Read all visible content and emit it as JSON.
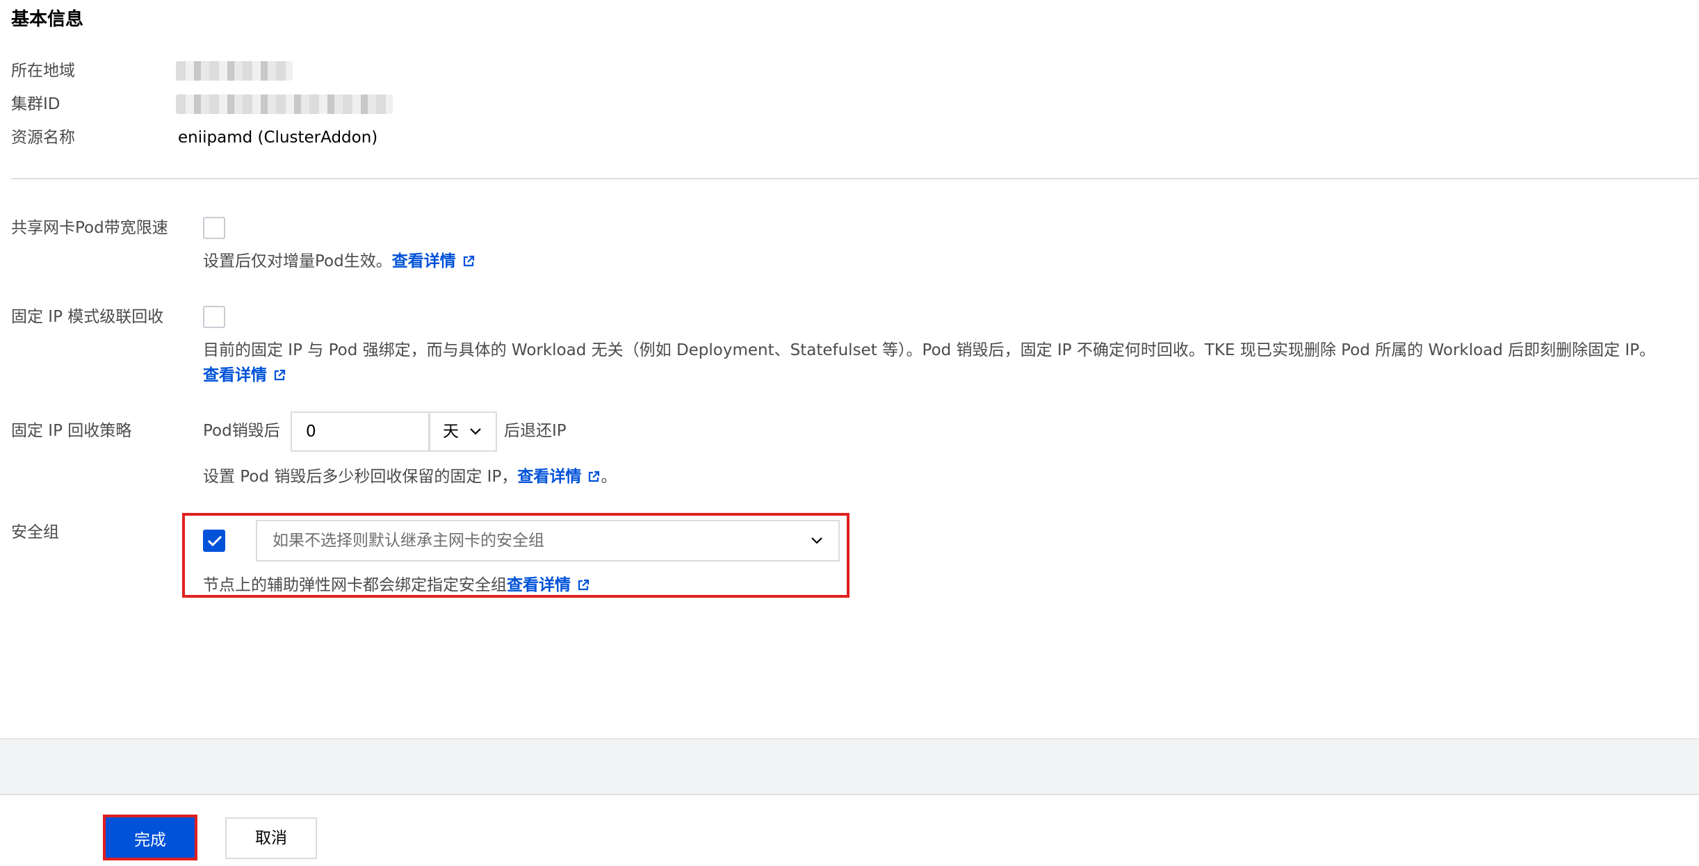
{
  "section_title": "基本信息",
  "basic_info": {
    "region_label": "所在地域",
    "cluster_id_label": "集群ID",
    "resource_name_label": "资源名称",
    "resource_name_value": "eniipamd (ClusterAddon)"
  },
  "bandwidth_limit": {
    "label": "共享网卡Pod带宽限速",
    "checked": false,
    "desc": "设置后仅对增量Pod生效。",
    "link": "查看详情"
  },
  "fixed_ip_cascade": {
    "label": "固定 IP 模式级联回收",
    "checked": false,
    "desc": "目前的固定 IP 与 Pod 强绑定，而与具体的 Workload 无关（例如 Deployment、Statefulset 等）。Pod 销毁后，固定 IP 不确定何时回收。TKE 现已实现删除 Pod 所属的 Workload 后即刻删除固定 IP。",
    "link": "查看详情"
  },
  "fixed_ip_policy": {
    "label": "固定 IP 回收策略",
    "prefix": "Pod销毁后",
    "value": "0",
    "unit": "天",
    "suffix": "后退还IP",
    "desc": "设置 Pod 销毁后多少秒回收保留的固定 IP，",
    "link": "查看详情",
    "desc_end": "。"
  },
  "security_group": {
    "label": "安全组",
    "checked": true,
    "placeholder": "如果不选择则默认继承主网卡的安全组",
    "desc": "节点上的辅助弹性网卡都会绑定指定安全组",
    "link": "查看详情"
  },
  "footer": {
    "confirm": "完成",
    "cancel": "取消"
  },
  "colors": {
    "primary": "#0052d9",
    "highlight": "#e02020",
    "link": "#0052d9"
  },
  "icons": {
    "external_link": "external-link-icon",
    "chevron": "chevron-down-icon",
    "check": "check-icon"
  }
}
